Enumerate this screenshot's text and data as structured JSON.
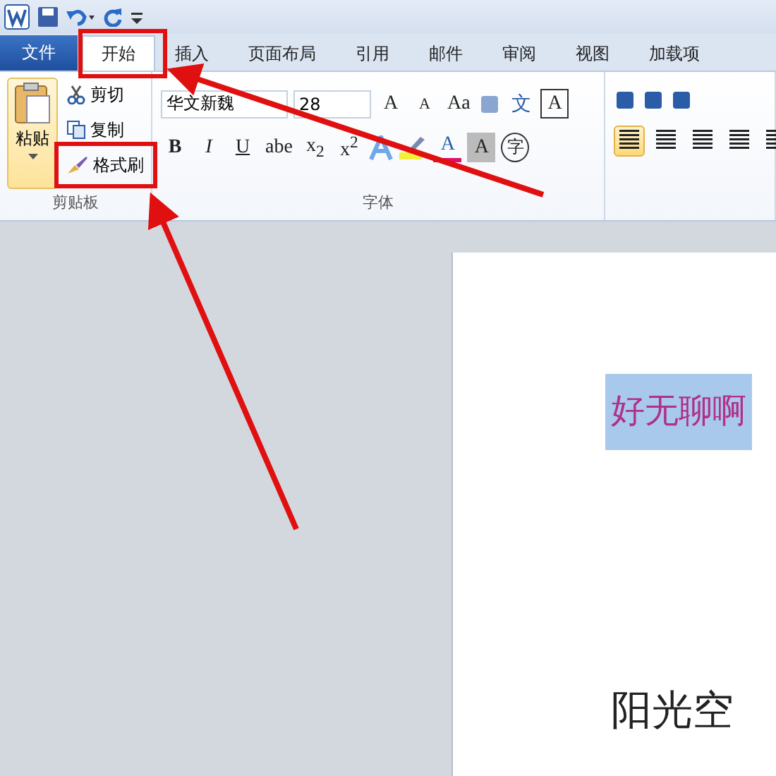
{
  "file_tab": "文件",
  "tabs": [
    {
      "label": "开始",
      "selected": true
    },
    {
      "label": "插入",
      "selected": false
    },
    {
      "label": "页面布局",
      "selected": false
    },
    {
      "label": "引用",
      "selected": false
    },
    {
      "label": "邮件",
      "selected": false
    },
    {
      "label": "审阅",
      "selected": false
    },
    {
      "label": "视图",
      "selected": false
    },
    {
      "label": "加载项",
      "selected": false
    }
  ],
  "clipboard": {
    "paste": "粘贴",
    "cut": "剪切",
    "copy": "复制",
    "format_painter": "格式刷",
    "label": "剪贴板"
  },
  "font": {
    "name": "华文新魏",
    "size": "28",
    "grow": "A",
    "shrink": "A",
    "change_case": "Aa",
    "phonetic": "文",
    "border": "A",
    "styles": [
      "B",
      "I",
      "U",
      "abe",
      "x$_{2}$",
      "x$^{2}$"
    ],
    "font_color": "A",
    "shading": "A",
    "enclose": "字",
    "label": "字体"
  },
  "paragraph": {
    "alignment": [
      {
        "selected": true
      },
      {
        "selected": false
      },
      {
        "selected": false
      },
      {
        "selected": false
      },
      {
        "selected": false
      }
    ]
  },
  "document": {
    "lines": [
      {
        "text": "好无聊啊",
        "selected": true
      },
      {
        "text": "阳光空",
        "selected": false
      }
    ]
  },
  "annotations": [
    {
      "kind": "frame"
    },
    {
      "kind": "frame"
    }
  ]
}
